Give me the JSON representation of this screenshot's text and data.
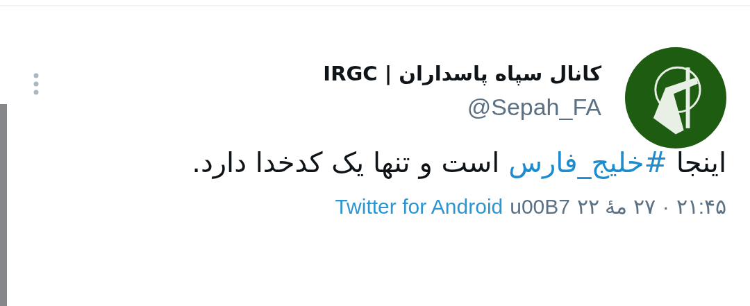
{
  "tweet": {
    "author": {
      "name": "کانال سپاه پاسداران | IRGC",
      "handle": "@Sepah_FA"
    },
    "text": [
      {
        "kind": "plain",
        "text": "اینجا "
      },
      {
        "kind": "hashtag",
        "text": "#خلیج_فارس"
      },
      {
        "kind": "plain",
        "text": " است و تنها یک کدخدا دارد."
      }
    ],
    "meta": [
      {
        "kind": "plain",
        "text": "۲۱:۴۵"
      },
      {
        "kind": "plain",
        "text": "·"
      },
      {
        "kind": "plain",
        "text": "۲۷ مۀ ۲۲"
      },
      {
        "kind": "plain",
        "text": "u00B7"
      },
      {
        "kind": "link",
        "text": "Twitter for Android"
      }
    ]
  }
}
